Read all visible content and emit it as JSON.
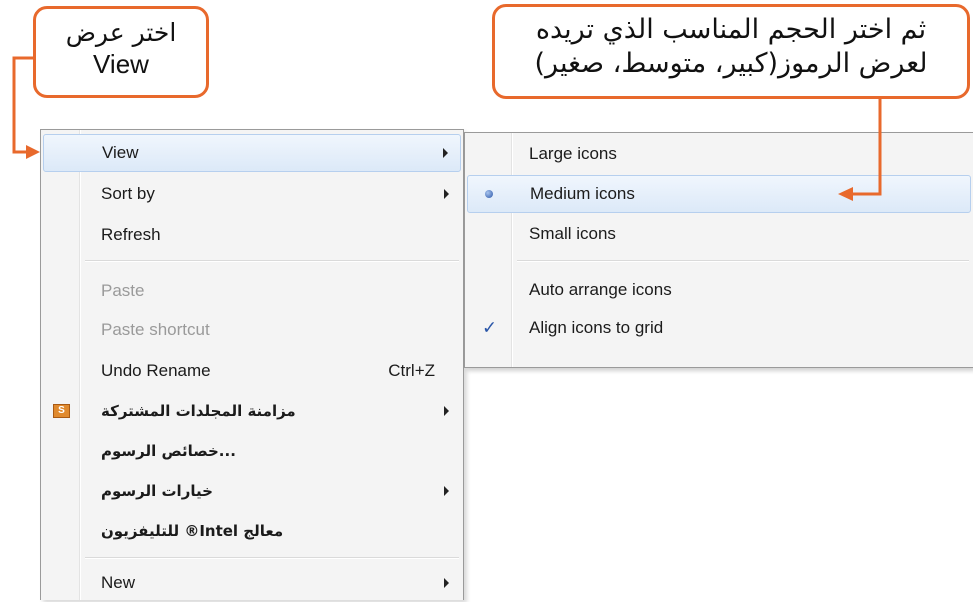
{
  "callouts": {
    "left": {
      "line1": "اختر عرض",
      "line2": "View"
    },
    "right": {
      "line1": "ثم اختر الحجم المناسب الذي تريده",
      "line2": "لعرض الرموز(كبير، متوسط، صغير)"
    }
  },
  "colors": {
    "callout_accent": "#e8692c",
    "highlight": "#dce9f8",
    "menu_bg": "#f4f4f4"
  },
  "context_menu": {
    "view": "View",
    "sort_by": "Sort by",
    "refresh": "Refresh",
    "paste": "Paste",
    "paste_shortcut": "Paste shortcut",
    "undo_rename": "Undo Rename",
    "undo_rename_shortcut": "Ctrl+Z",
    "sync_icon": "S",
    "sync_shared_folders": "مزامنة المجلدات المشتركة",
    "graphics_properties": "...خصائص الرسوم",
    "graphics_options": "خيارات الرسوم",
    "intel_wizard": "معالج Intel® للتليفزيون",
    "new": "New"
  },
  "view_submenu": {
    "large_icons": "Large icons",
    "medium_icons": "Medium icons",
    "small_icons": "Small icons",
    "auto_arrange_icons": "Auto arrange icons",
    "align_icons_to_grid": "Align icons to grid",
    "selected": "medium_icons",
    "checked": [
      "align_icons_to_grid"
    ]
  }
}
